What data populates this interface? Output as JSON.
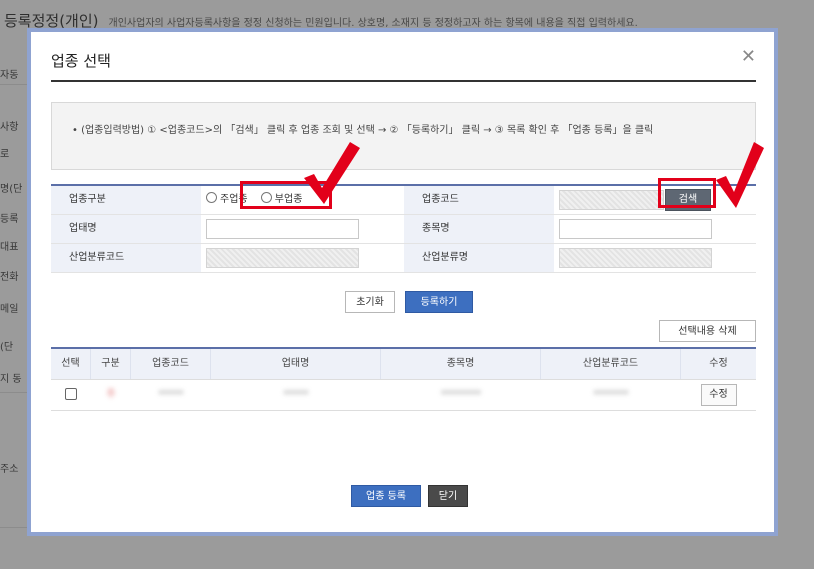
{
  "background": {
    "title": "등록정정(개인)",
    "subtitle": "개인사업자의 사업자등록사항을 정정 신청하는 민원입니다. 상호명, 소재지 등 정정하고자 하는 항목에 내용을 직접 입력하세요.",
    "side_labels": [
      "자동",
      "사항",
      "로",
      "명(단",
      "등록",
      "대표",
      "전화",
      "메일",
      "(단",
      "지 동",
      "주소"
    ]
  },
  "modal": {
    "title": "업종 선택",
    "close_icon": "close-icon",
    "info_text": "• (업종입력방법) ① <업종코드>의 「검색」 클릭 후 업종 조회 및 선택 → ② 「등록하기」 클릭 → ③ 목록 확인 후 「업종 등록」을 클릭",
    "form": {
      "type_label": "업종구분",
      "radio_main": "주업종",
      "radio_sub": "부업종",
      "code_label": "업종코드",
      "search_button": "검색",
      "business_type_label": "업태명",
      "item_label": "종목명",
      "industry_code_label": "산업분류코드",
      "industry_name_label": "산업분류명"
    },
    "reset_button": "초기화",
    "add_button": "등록하기",
    "delete_selected_button": "선택내용 삭제",
    "grid": {
      "columns": [
        "선택",
        "구분",
        "업종코드",
        "업태명",
        "종목명",
        "산업분류코드",
        "수정"
      ],
      "rows": [
        {
          "type": "주",
          "code": "*****",
          "business": "*****",
          "item": "********",
          "industry": "*******",
          "edit": "수정"
        }
      ]
    },
    "register_button": "업종 등록",
    "close_button": "닫기"
  },
  "annotations": {
    "highlight_color": "#e2001a",
    "checkmark_icon": "red-checkmark-icon"
  }
}
